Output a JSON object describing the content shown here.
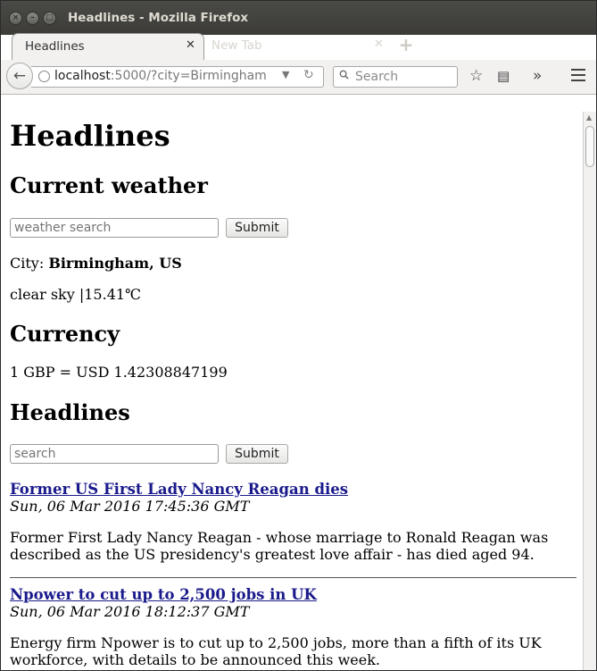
{
  "window": {
    "title": "Headlines - Mozilla Firefox"
  },
  "tabs": [
    {
      "label": "Headlines",
      "active": true
    },
    {
      "label": "New Tab",
      "active": false
    }
  ],
  "navbar": {
    "url_host": "localhost",
    "url_rest": ":5000/?city=Birmingham",
    "search_placeholder": "Search"
  },
  "page": {
    "title": "Headlines",
    "weather": {
      "heading": "Current weather",
      "search_placeholder": "weather search",
      "submit_label": "Submit",
      "city_prefix": "City: ",
      "city": "Birmingham, US",
      "description": "clear sky |15.41℃"
    },
    "currency": {
      "heading": "Currency",
      "rate_text": "1 GBP = USD 1.42308847199"
    },
    "headlines": {
      "heading": "Headlines",
      "search_placeholder": "search",
      "submit_label": "Submit",
      "articles": [
        {
          "title": "Former US First Lady Nancy Reagan dies",
          "date": "Sun, 06 Mar 2016 17:45:36 GMT",
          "description": "Former First Lady Nancy Reagan - whose marriage to Ronald Reagan was described as the US presidency's greatest love affair - has died aged 94."
        },
        {
          "title": "Npower to cut up to 2,500 jobs in UK",
          "date": "Sun, 06 Mar 2016 18:12:37 GMT",
          "description": "Energy firm Npower is to cut up to 2,500 jobs, more than a fifth of its UK workforce, with details to be announced this week."
        }
      ]
    }
  }
}
